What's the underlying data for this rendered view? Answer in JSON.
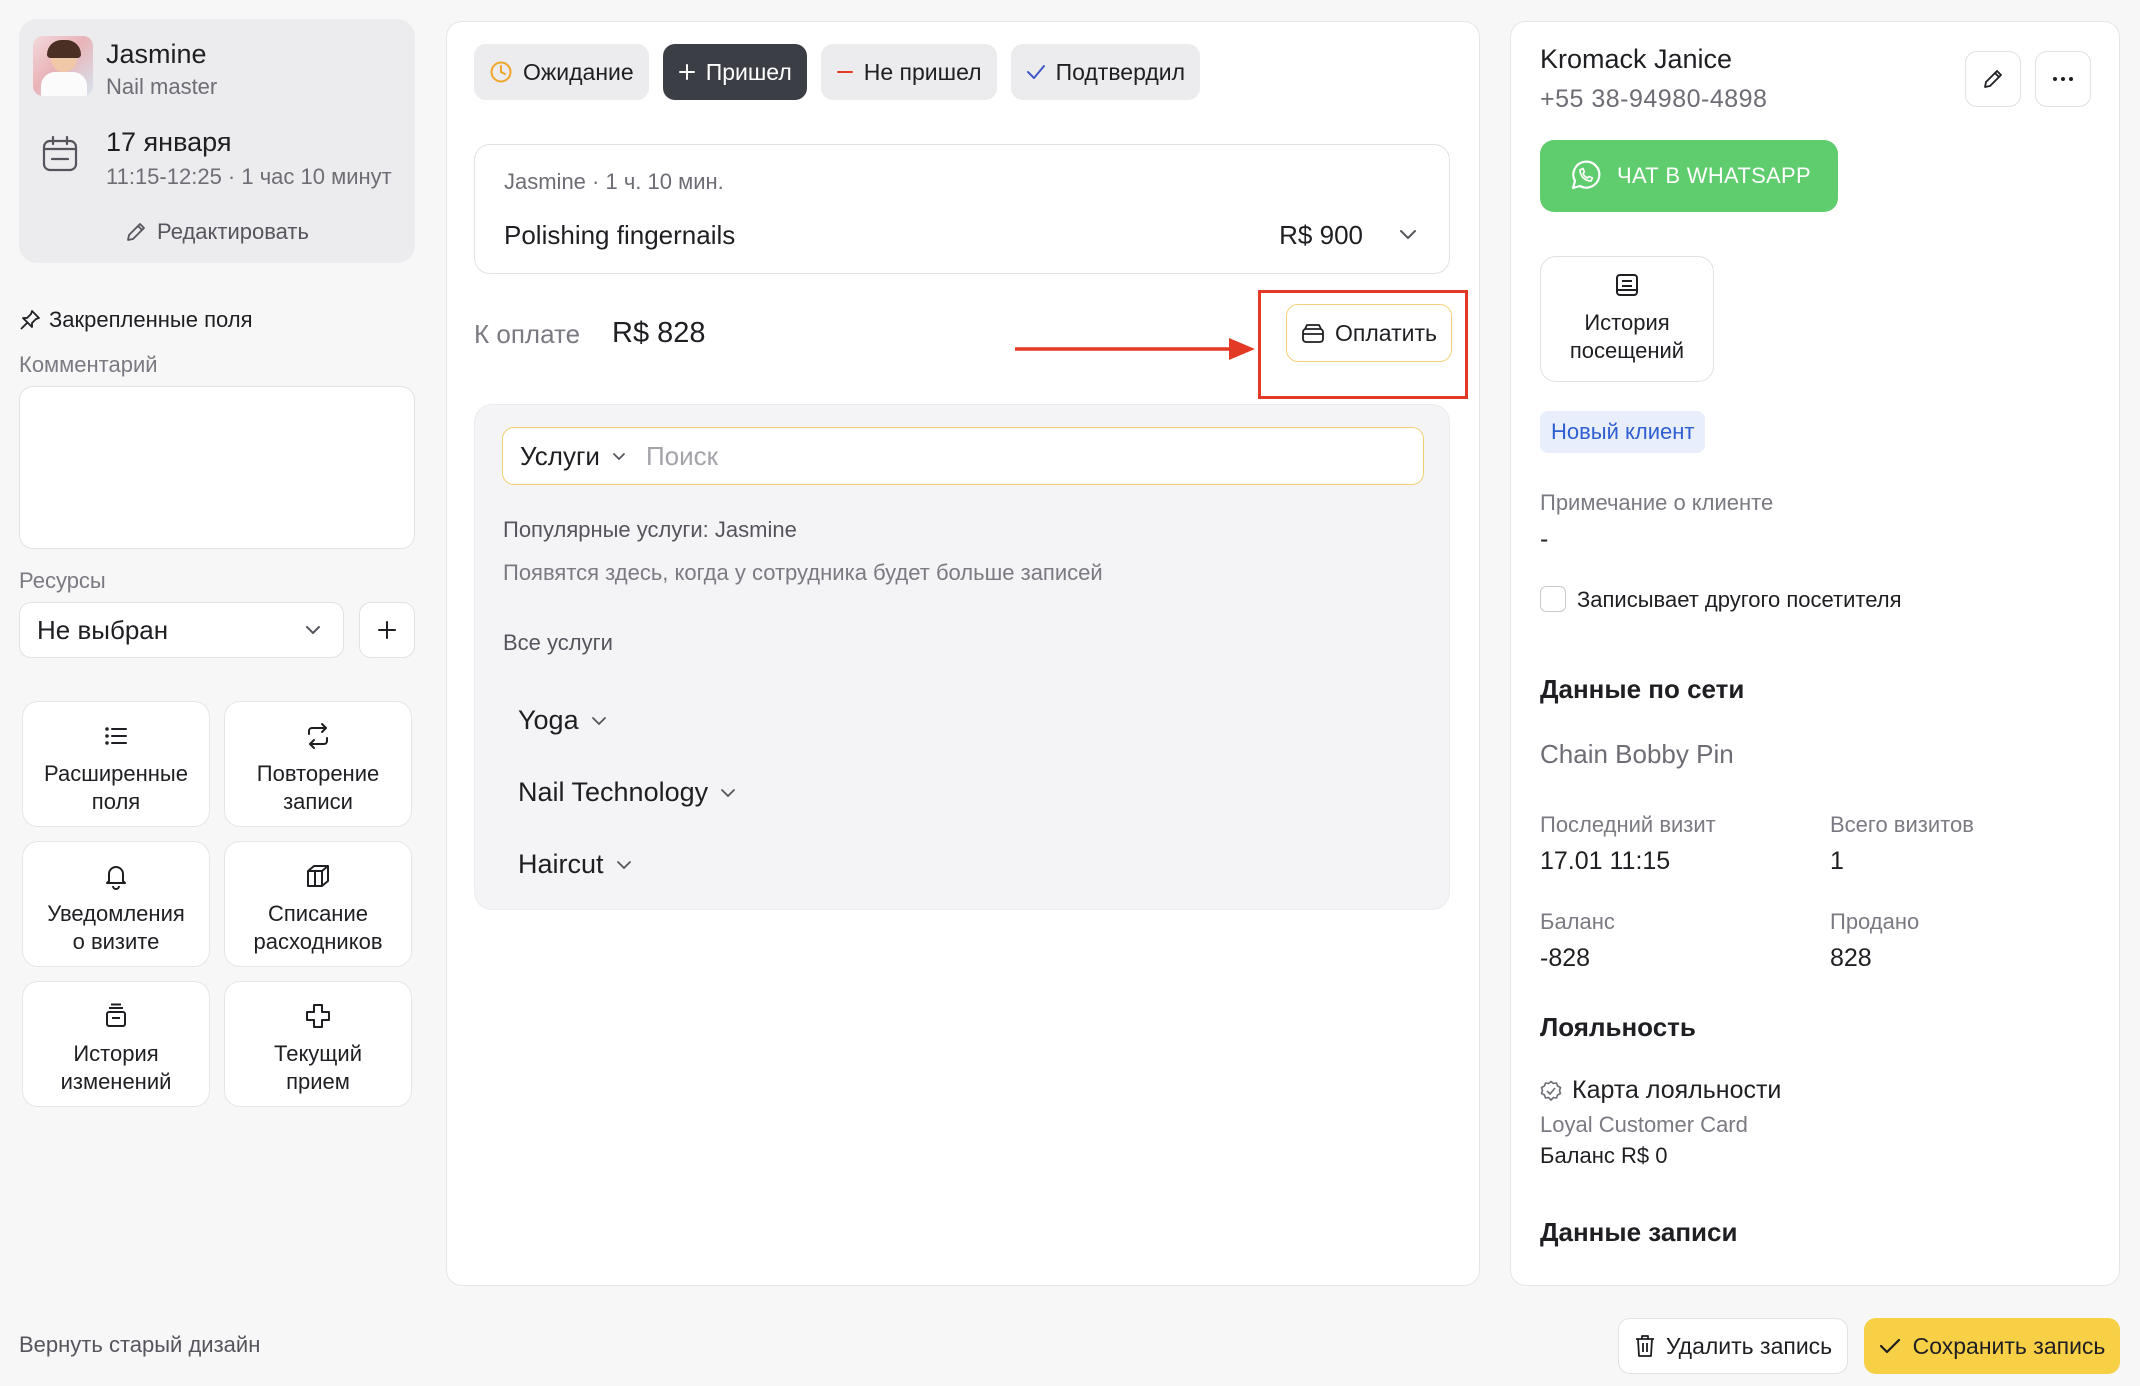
{
  "master": {
    "name": "Jasmine",
    "role": "Nail master",
    "date": "17 января",
    "time_range": "11:15-12:25 · 1 час 10 минут",
    "edit_label": "Редактировать"
  },
  "left": {
    "pinned_title": "Закрепленные поля",
    "comment_label": "Комментарий",
    "resources_label": "Ресурсы",
    "resources_value": "Не выбран",
    "tiles": [
      {
        "label": "Расширенные\nполя",
        "icon": "list-icon"
      },
      {
        "label": "Повторение\nзаписи",
        "icon": "repeat-icon"
      },
      {
        "label": "Уведомления\nо визите",
        "icon": "bell-icon"
      },
      {
        "label": "Списание\nрасходников",
        "icon": "box-icon"
      },
      {
        "label": "История\nизменений",
        "icon": "history-icon"
      },
      {
        "label": "Текущий\nприем",
        "icon": "medical-cross-icon"
      }
    ],
    "old_design_label": "Вернуть старый дизайн"
  },
  "status": {
    "buttons": [
      {
        "label": "Ожидание",
        "icon": "clock-icon"
      },
      {
        "label": "Пришел",
        "icon": "plus-icon",
        "active": true
      },
      {
        "label": "Не пришел",
        "icon": "minus-icon"
      },
      {
        "label": "Подтвердил",
        "icon": "check-icon"
      }
    ]
  },
  "service": {
    "meta": "Jasmine · 1 ч. 10 мин.",
    "name": "Polishing fingernails",
    "price": "R$ 900"
  },
  "payment": {
    "label": "К оплате",
    "amount": "R$ 828",
    "pay_button": "Оплатить"
  },
  "services_picker": {
    "category": "Услуги",
    "search_placeholder": "Поиск",
    "popular_title": "Популярные услуги: Jasmine",
    "popular_hint": "Появятся здесь, когда у сотрудника будет больше записей",
    "all_title": "Все услуги",
    "categories": [
      "Yoga",
      "Nail Technology",
      "Haircut"
    ]
  },
  "client": {
    "name": "Kromack Janice",
    "phone": "+55 38-94980-4898",
    "whatsapp_label": "ЧАТ В WHATSAPP",
    "history_label": "История\nпосещений",
    "badge": "Новый клиент",
    "note_label": "Примечание о клиенте",
    "note_value": "-",
    "other_visitor_label": "Записывает другого посетителя"
  },
  "network": {
    "title": "Данные по сети",
    "chain": "Chain Bobby Pin",
    "last_visit_label": "Последний визит",
    "last_visit_value": "17.01 11:15",
    "total_visits_label": "Всего визитов",
    "total_visits_value": "1",
    "balance_label": "Баланс",
    "balance_value": "-828",
    "sold_label": "Продано",
    "sold_value": "828"
  },
  "loyalty": {
    "title": "Лояльность",
    "card_title": "Карта лояльности",
    "card_name": "Loyal Customer Card",
    "card_balance": "Баланс R$ 0"
  },
  "record": {
    "title": "Данные записи"
  },
  "footer": {
    "delete_label": "Удалить запись",
    "save_label": "Сохранить запись"
  },
  "colors": {
    "whatsapp": "#5fcc6d",
    "save": "#f7d046",
    "highlight": "#e33a25",
    "active_status": "#3b3e44",
    "badge_text": "#2f5fd0"
  }
}
